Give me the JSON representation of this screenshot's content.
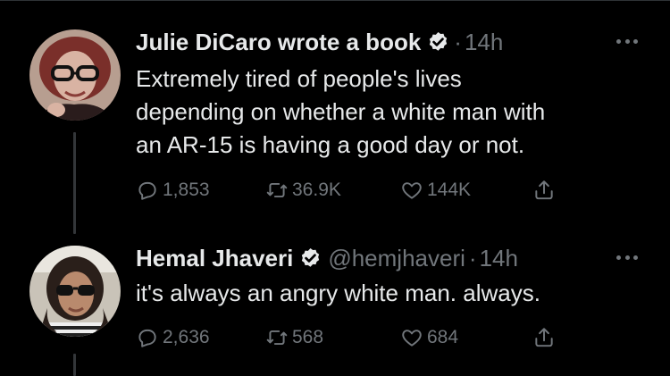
{
  "tweets": [
    {
      "name": "Julie DiCaro wrote a book",
      "handle": "",
      "time": "14h",
      "text_lines": [
        "Extremely tired of people's lives",
        "depending on whether a white man with",
        "an AR-15 is having a good day or not."
      ],
      "replies": "1,853",
      "retweets": "36.9K",
      "likes": "144K",
      "verified": true
    },
    {
      "name": "Hemal Jhaveri",
      "handle": "@hemjhaveri",
      "time": "14h",
      "text_lines": [
        "it's always an angry white man. always."
      ],
      "replies": "2,636",
      "retweets": "568",
      "likes": "684",
      "verified": true
    }
  ],
  "colors": {
    "background": "#000000",
    "text": "#e7e9ea",
    "secondary": "#71767b",
    "thread_line": "#333639"
  },
  "icons": [
    "verified-badge-icon",
    "more-icon",
    "reply-icon",
    "retweet-icon",
    "like-icon",
    "share-icon"
  ]
}
